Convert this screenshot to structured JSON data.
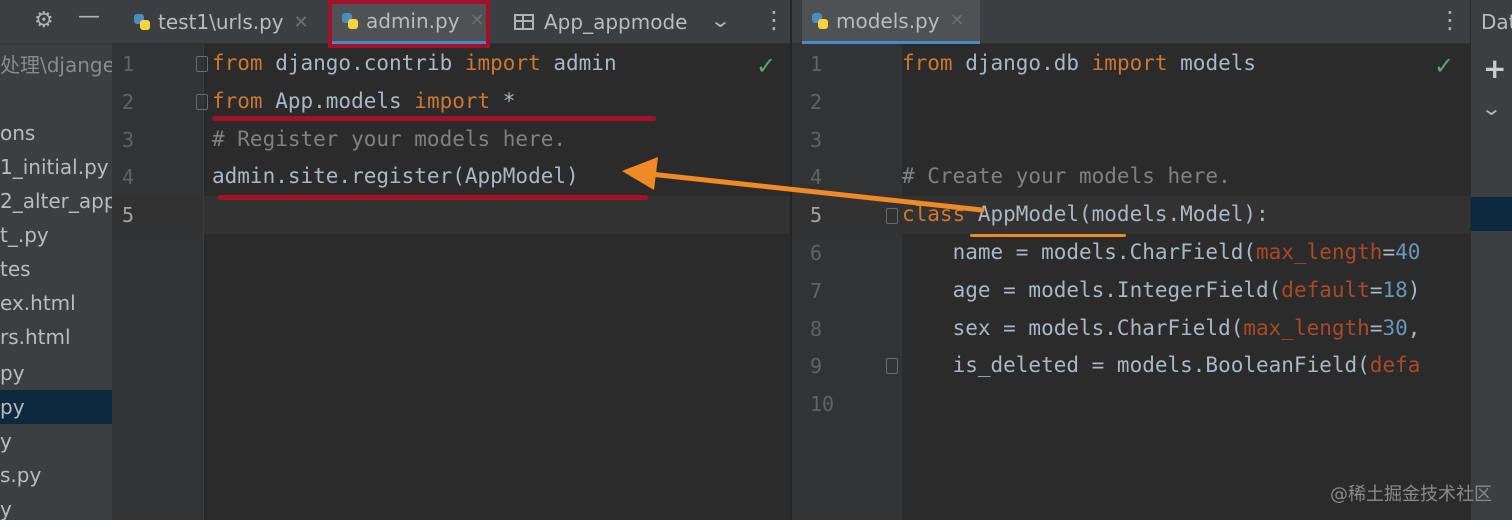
{
  "tabs_left": {
    "tab1": "test1\\urls.py",
    "tab2": "admin.py",
    "tab3": "App_appmode"
  },
  "tabs_right": {
    "tab1": "models.py"
  },
  "tool_strip_title": "Dat",
  "sidebar": {
    "items": [
      "处理\\djange",
      "ons",
      "1_initial.py",
      "2_alter_app",
      "t_.py",
      "tes",
      "ex.html",
      "rs.html",
      "py",
      "py",
      "y",
      "s.py",
      "y"
    ]
  },
  "left_editor": {
    "line_numbers": [
      "1",
      "2",
      "3",
      "4",
      "5"
    ],
    "lines": [
      [
        {
          "t": "from",
          "c": "kw"
        },
        {
          "t": " django.contrib ",
          "c": ""
        },
        {
          "t": "import",
          "c": "kw"
        },
        {
          "t": " admin",
          "c": ""
        }
      ],
      [
        {
          "t": "from",
          "c": "kw"
        },
        {
          "t": " App.models ",
          "c": ""
        },
        {
          "t": "import",
          "c": "kw"
        },
        {
          "t": " *",
          "c": ""
        }
      ],
      [
        {
          "t": "# Register your models here.",
          "c": "cm"
        }
      ],
      [
        {
          "t": "admin.site.register(AppModel)",
          "c": ""
        }
      ],
      []
    ]
  },
  "right_editor": {
    "line_numbers": [
      "1",
      "2",
      "3",
      "4",
      "5",
      "6",
      "7",
      "8",
      "9",
      "10"
    ],
    "lines": [
      [
        {
          "t": "from",
          "c": "kw"
        },
        {
          "t": " django.db ",
          "c": ""
        },
        {
          "t": "import",
          "c": "kw"
        },
        {
          "t": " models",
          "c": ""
        }
      ],
      [],
      [],
      [
        {
          "t": "# Create your models here.",
          "c": "cm"
        }
      ],
      [
        {
          "t": "class",
          "c": "kw"
        },
        {
          "t": " AppModel(models.Model):",
          "c": ""
        }
      ],
      [
        {
          "t": "    name = models.CharField(",
          "c": ""
        },
        {
          "t": "max_length",
          "c": "prm"
        },
        {
          "t": "=",
          "c": ""
        },
        {
          "t": "40",
          "c": "num"
        }
      ],
      [
        {
          "t": "    age = models.IntegerField(",
          "c": ""
        },
        {
          "t": "default",
          "c": "prm"
        },
        {
          "t": "=",
          "c": ""
        },
        {
          "t": "18",
          "c": "num"
        },
        {
          "t": ")",
          "c": ""
        }
      ],
      [
        {
          "t": "    sex = models.CharField(",
          "c": ""
        },
        {
          "t": "max_length",
          "c": "prm"
        },
        {
          "t": "=",
          "c": ""
        },
        {
          "t": "30",
          "c": "num"
        },
        {
          "t": ",",
          "c": ""
        }
      ],
      [
        {
          "t": "    is_deleted = models.BooleanField(",
          "c": ""
        },
        {
          "t": "defa",
          "c": "prm"
        }
      ],
      []
    ]
  },
  "watermark": "@稀土掘金技术社区",
  "colors": {
    "keyword": "#cc7832",
    "comment": "#808080",
    "param": "#aa4926",
    "number": "#6897bb",
    "annotation_red": "#a1122a",
    "annotation_orange": "#f08a24"
  }
}
